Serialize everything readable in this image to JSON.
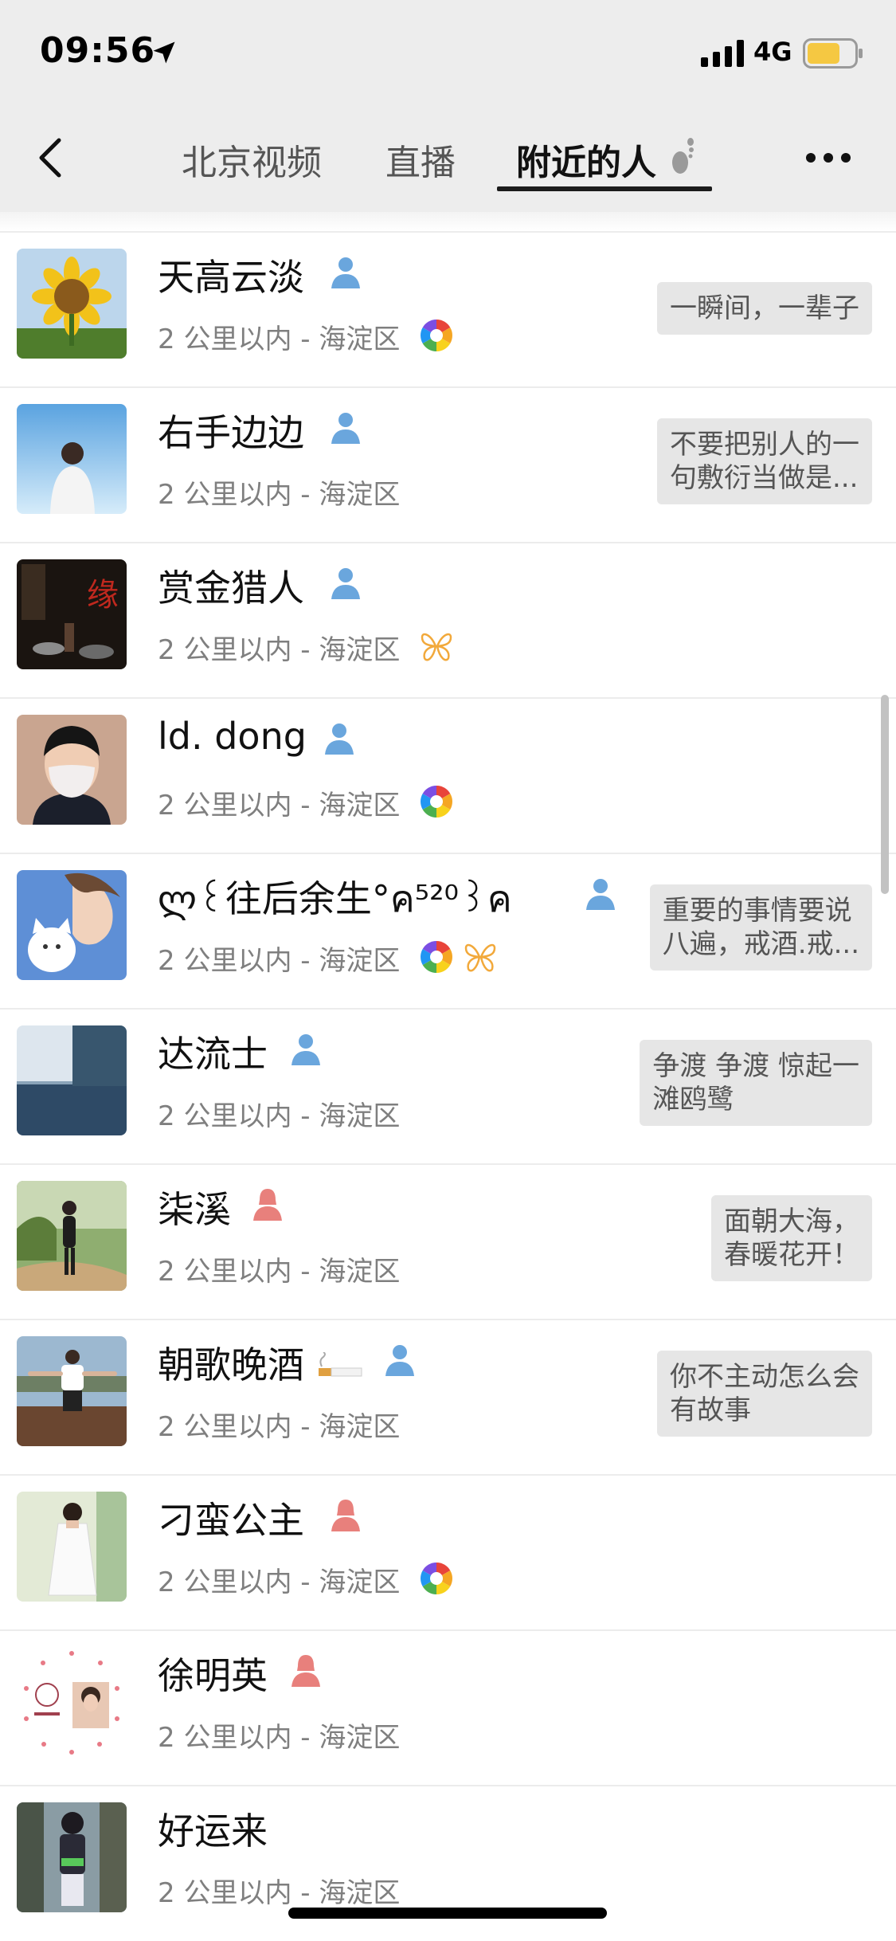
{
  "status_bar": {
    "time": "09:56",
    "network": "4G",
    "battery_color": "#f5c842"
  },
  "nav": {
    "tabs": [
      {
        "label": "北京视频",
        "active": false
      },
      {
        "label": "直播",
        "active": false
      },
      {
        "label": "附近的人",
        "active": true
      }
    ]
  },
  "colors": {
    "male": "#6aa6dd",
    "female": "#e8807c",
    "background": "#ffffff",
    "header": "#ededed",
    "signature_bg": "#e6e6e6"
  },
  "people": [
    {
      "name": "天高云淡",
      "gender": "male",
      "distance": "2 公里以内 - 海淀区",
      "badges": [
        "moments-icon"
      ],
      "signature": "一瞬间，一辈子"
    },
    {
      "name": "右手边边",
      "gender": "male",
      "distance": "2 公里以内 - 海淀区",
      "badges": [],
      "signature": "不要把别人的一\n句敷衍当做是..."
    },
    {
      "name": "赏金猎人",
      "gender": "male",
      "distance": "2 公里以内 - 海淀区",
      "badges": [
        "butterfly-icon"
      ],
      "signature": ""
    },
    {
      "name": "ld. dong",
      "gender": "male",
      "distance": "2 公里以内 - 海淀区",
      "badges": [
        "moments-icon"
      ],
      "signature": ""
    },
    {
      "name": "ლ꒰往后余生°ค⁵²⁰꒱ค",
      "gender": "male",
      "distance": "2 公里以内 - 海淀区",
      "badges": [
        "moments-icon",
        "butterfly-icon"
      ],
      "signature": "重要的事情要说\n八遍，戒酒.戒..."
    },
    {
      "name": "达流士",
      "gender": "male",
      "distance": "2 公里以内 - 海淀区",
      "badges": [],
      "signature": "争渡 争渡 惊起一\n滩鸥鹭"
    },
    {
      "name": "柒溪",
      "gender": "female",
      "distance": "2 公里以内 - 海淀区",
      "badges": [],
      "signature": "面朝大海，\n春暖花开！"
    },
    {
      "name": "朝歌晚酒",
      "gender": "male",
      "distance": "2 公里以内 - 海淀区",
      "badges": [],
      "signature": "你不主动怎么会\n有故事"
    },
    {
      "name": "刁蛮公主",
      "gender": "female",
      "distance": "2 公里以内 - 海淀区",
      "badges": [
        "moments-icon"
      ],
      "signature": ""
    },
    {
      "name": "徐明英",
      "gender": "female",
      "distance": "2 公里以内 - 海淀区",
      "badges": [],
      "signature": ""
    },
    {
      "name": "好运来",
      "gender": "",
      "distance": "2 公里以内 - 海淀区",
      "badges": [],
      "signature": ""
    }
  ]
}
